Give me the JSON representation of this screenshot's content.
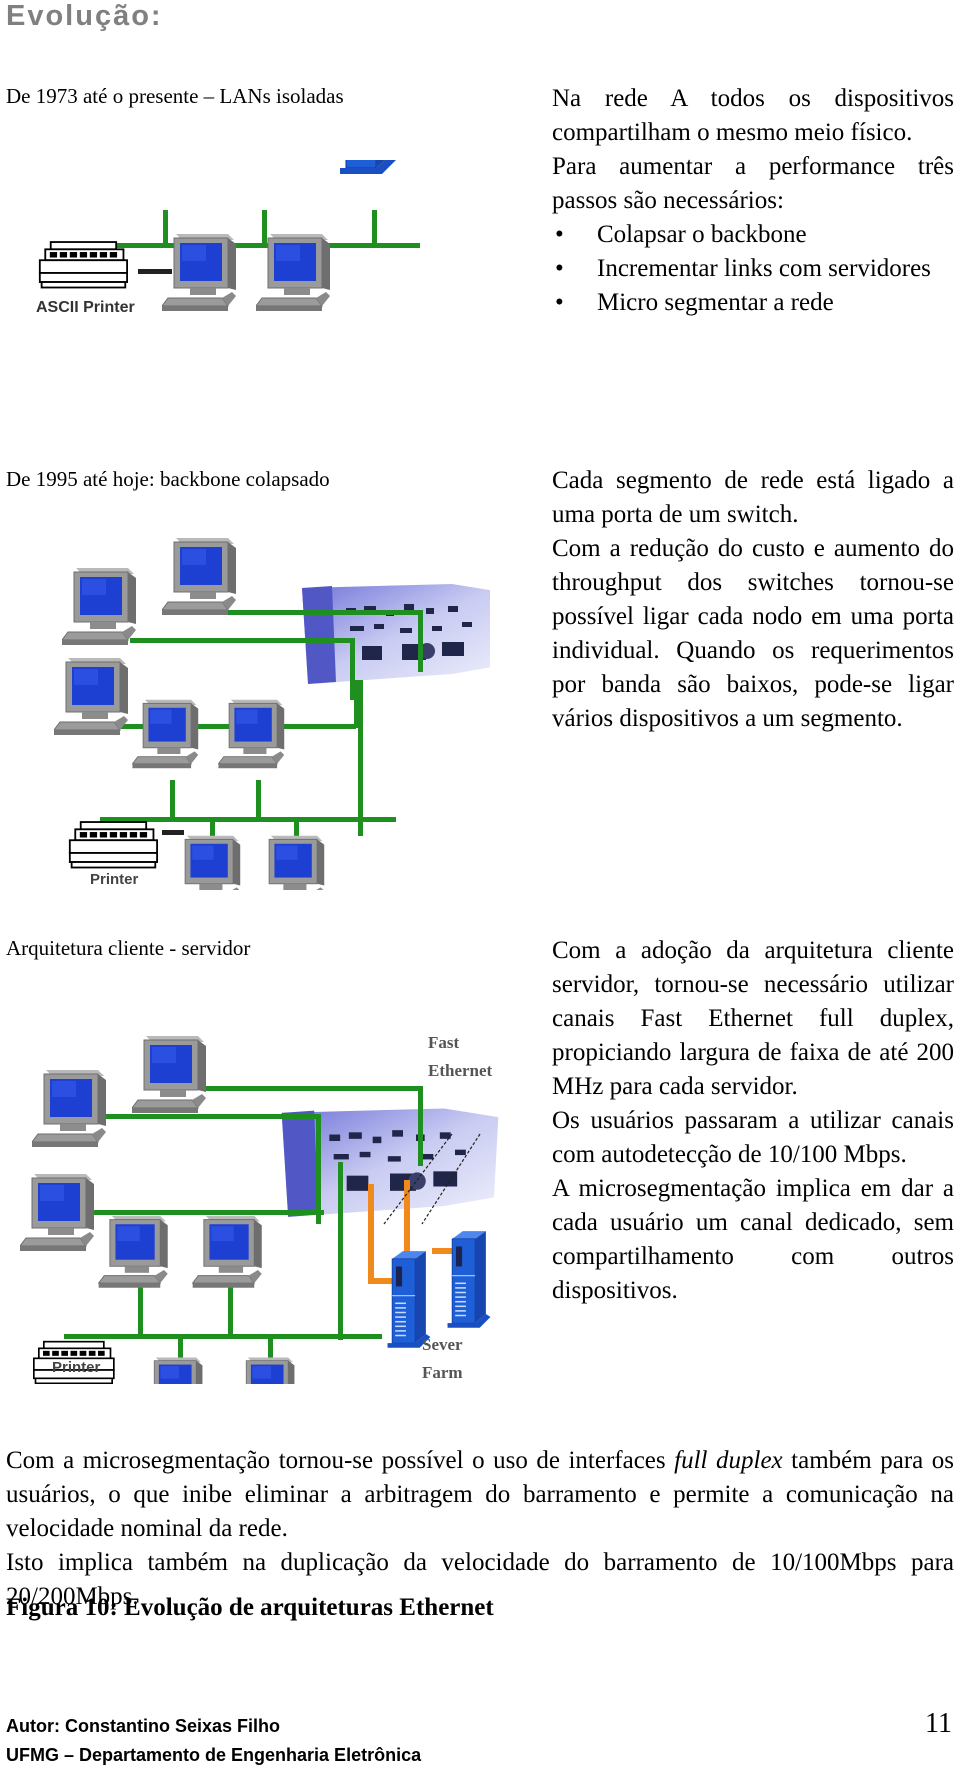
{
  "page": {
    "title": "Evolução:"
  },
  "sections": [
    {
      "caption": "De 1973 até o presente – LANs isoladas",
      "diagram": {
        "labels": {
          "printer": "ASCII Printer"
        },
        "colors": {
          "bus": "#1f8f1f",
          "screen": "#1a3fd6",
          "server": "#1e5fd8",
          "monitor": "#8a8a8a"
        }
      },
      "paragraphs": [
        "Na rede A todos os dispositivos compartilham o mesmo meio físico.",
        "Para aumentar a performance três passos são necessários:"
      ],
      "bullets": [
        "Colapsar o backbone",
        "Incrementar links com servidores",
        "Micro segmentar a rede"
      ],
      "bullet_glyph": "•"
    },
    {
      "caption": "De 1995 até hoje: backbone colapsado",
      "diagram": {
        "labels": {
          "printer": "Printer"
        }
      },
      "paragraphs": [
        "Cada segmento de rede está ligado a uma porta de um switch.",
        "Com a redução do custo e aumento do throughput dos switches tornou-se possível ligar cada nodo em uma porta individual. Quando os requerimentos por banda são baixos, pode-se ligar vários dispositivos a um segmento."
      ]
    },
    {
      "caption": "Arquitetura cliente  - servidor",
      "diagram": {
        "labels": {
          "printer": "Printer",
          "fast_line1": "Fast",
          "fast_line2": "Ethernet",
          "farm_line1": "Sever",
          "farm_line2": "Farm"
        },
        "colors": {
          "fast_link": "#f08a1c"
        }
      },
      "paragraphs": [
        "Com a adoção da arquitetura cliente servidor, tornou-se necessário utilizar canais Fast Ethernet full duplex, propiciando largura de faixa de até 200 MHz para cada servidor.",
        "Os usuários passaram a utilizar canais com autodetecção de 10/100 Mbps.",
        "A microsegmentação implica em dar a cada usuário um canal dedicado, sem compartilhamento com outros dispositivos."
      ]
    }
  ],
  "body": {
    "p1_before": "Com a microsegmentação tornou-se possível o uso de interfaces ",
    "p1_italic": "full duplex",
    "p1_after": " também para os usuários, o que inibe eliminar a arbitragem do barramento e permite a comunicação na velocidade nominal da rede.",
    "p2": "Isto implica também na duplicação da velocidade do barramento de 10/100Mbps para 20/200Mbps."
  },
  "figure": {
    "label": "Figura 10",
    "separator": ": ",
    "text": "Evolução de arquiteturas Ethernet"
  },
  "footer": {
    "author": "Autor: Constantino Seixas Filho",
    "department": "UFMG – Departamento de Engenharia Eletrônica",
    "page_number": "11"
  }
}
